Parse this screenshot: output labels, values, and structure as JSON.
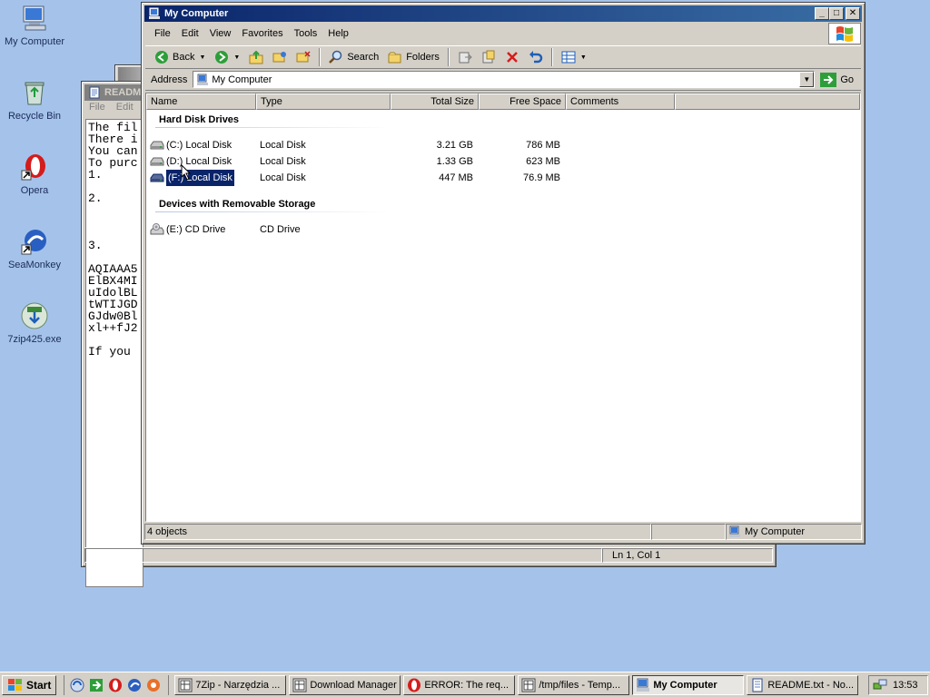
{
  "desktop": {
    "icons": [
      {
        "label": "My Computer"
      },
      {
        "label": "Recycle Bin"
      },
      {
        "label": "Opera"
      },
      {
        "label": "SeaMonkey"
      },
      {
        "label": "7zip425.exe"
      }
    ]
  },
  "readme_window": {
    "title": "READM",
    "menu": [
      "File",
      "Edit"
    ],
    "text_lines": [
      "The fil",
      "There i",
      "You can",
      "To purc",
      "1.",
      "",
      "2.",
      "",
      "",
      "",
      "3.",
      "",
      "AQIAAA5",
      "ElBX4MI",
      "uIdolBL",
      "tWTIJGD",
      "GJdw0Bl",
      "xl++fJ2",
      "",
      "If you"
    ],
    "status": "Ln 1, Col 1"
  },
  "mycomputer_window": {
    "title": "My Computer",
    "menu": [
      "File",
      "Edit",
      "View",
      "Favorites",
      "Tools",
      "Help"
    ],
    "toolbar": {
      "back": "Back",
      "search": "Search",
      "folders": "Folders"
    },
    "address": {
      "label": "Address",
      "value": "My Computer",
      "go": "Go"
    },
    "columns": [
      "Name",
      "Type",
      "Total Size",
      "Free Space",
      "Comments"
    ],
    "groups": [
      {
        "title": "Hard Disk Drives",
        "items": [
          {
            "name": "(C:) Local Disk",
            "type": "Local Disk",
            "total": "3.21 GB",
            "free": "786 MB",
            "selected": false
          },
          {
            "name": "(D:) Local Disk",
            "type": "Local Disk",
            "total": "1.33 GB",
            "free": "623 MB",
            "selected": false
          },
          {
            "name": "(F:) Local Disk",
            "type": "Local Disk",
            "total": "447 MB",
            "free": "76.9 MB",
            "selected": true
          }
        ]
      },
      {
        "title": "Devices with Removable Storage",
        "items": [
          {
            "name": "(E:) CD Drive",
            "type": "CD Drive",
            "total": "",
            "free": "",
            "selected": false
          }
        ]
      }
    ],
    "status": {
      "objects": "4 objects",
      "location": "My Computer"
    }
  },
  "taskbar": {
    "start": "Start",
    "tasks": [
      {
        "label": "7Zip - Narzędzia ...",
        "active": false
      },
      {
        "label": "Download Manager",
        "active": false
      },
      {
        "label": "ERROR: The req...",
        "active": false
      },
      {
        "label": "/tmp/files - Temp...",
        "active": false
      },
      {
        "label": "My Computer",
        "active": true
      },
      {
        "label": "README.txt - No...",
        "active": false
      }
    ],
    "clock": "13:53"
  },
  "colors": {
    "desktop": "#a5c3ea",
    "titlebar_active": "#0a246a",
    "selection": "#0a246a",
    "opera_red": "#d51c1c",
    "go_green": "#2e9e3a"
  }
}
